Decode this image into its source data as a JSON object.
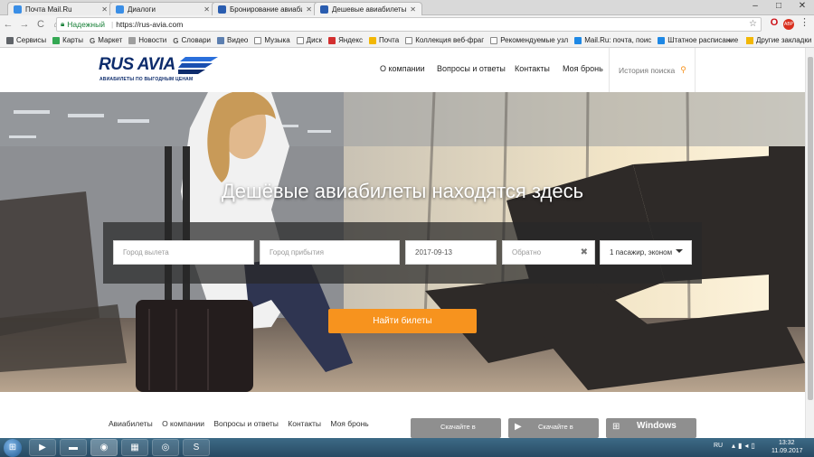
{
  "browser": {
    "tabs": [
      {
        "title": "Почта Mail.Ru",
        "color": "#3a8ee6"
      },
      {
        "title": "Диалоги",
        "color": "#3a8ee6"
      },
      {
        "title": "Бронирование авиабил",
        "color": "#2a5db0"
      },
      {
        "title": "Дешевые авиабилеты з",
        "color": "#2a5db0"
      }
    ],
    "window_controls": [
      "–",
      "□",
      "✕"
    ],
    "nav": {
      "back": "←",
      "forward": "→",
      "reload": "C",
      "home": "⌂"
    },
    "secure_label": "Надежный",
    "url": "https://rus-avia.com",
    "extensions": {
      "opera": "O",
      "abp": "ABP"
    },
    "bookmarks": [
      {
        "label": "Сервисы",
        "color": "#5f6368"
      },
      {
        "label": "Карты",
        "color": "#34a853"
      },
      {
        "label": "Маркет",
        "color": "#777777"
      },
      {
        "label": "Новости",
        "color": "#777777"
      },
      {
        "label": "Словари",
        "color": "#777777"
      },
      {
        "label": "Видео",
        "color": "#777777"
      },
      {
        "label": "Музыка",
        "color": "#777777"
      },
      {
        "label": "Диск",
        "color": "#777777"
      },
      {
        "label": "Яндекс",
        "color": "#d32f2f"
      },
      {
        "label": "Почта",
        "color": "#f2b705"
      },
      {
        "label": "Коллекция веб-фраг",
        "color": "#777777"
      },
      {
        "label": "Рекомендуемые узл",
        "color": "#777777"
      },
      {
        "label": "Mail.Ru: почта, поис",
        "color": "#1e88e5"
      },
      {
        "label": "Штатное расписание",
        "color": "#1e88e5"
      }
    ],
    "bookmarks_more": "»",
    "other_bookmarks": "Другие закладки"
  },
  "site": {
    "logo_text": "RUS AVIA",
    "logo_tagline": "АВИАБИЛЕТЫ ПО ВЫГОДНЫМ ЦЕНАМ",
    "nav": [
      "О компании",
      "Вопросы и ответы",
      "Контакты",
      "Моя бронь"
    ],
    "history_label": "История поиска",
    "hero_title": "Дешёвые авиабилеты находятся здесь",
    "search": {
      "from_placeholder": "Город вылета",
      "to_placeholder": "Город прибытия",
      "date_value": "2017-09-13",
      "return_placeholder": "Обратно",
      "passengers_value": "1 пасажир, эконом",
      "find_button": "Найти билеты"
    },
    "footer_nav": [
      "Авиабилеты",
      "О компании",
      "Вопросы и ответы",
      "Контакты",
      "Моя бронь"
    ],
    "stores": [
      {
        "top": "Скачайте в",
        "icon": "apple-icon"
      },
      {
        "top": "Скачайте в",
        "icon": "android-icon"
      },
      {
        "top": "Windows",
        "icon": "windows-icon"
      }
    ],
    "accent_color": "#f7931e",
    "brand_color": "#0d2c6c"
  },
  "taskbar": {
    "language": "RU",
    "time": "13:32",
    "date": "11.09.2017"
  }
}
